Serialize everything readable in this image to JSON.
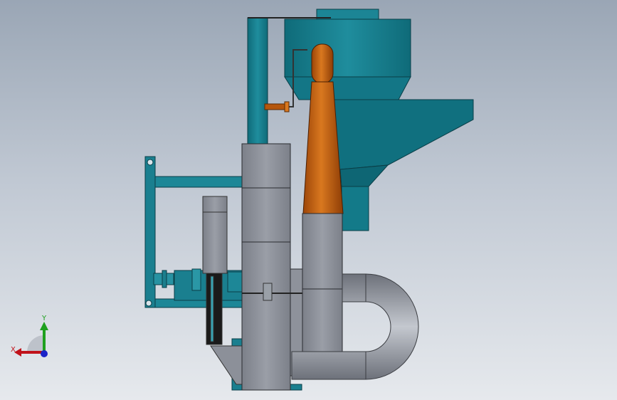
{
  "viewport": {
    "background_top": "#9aa6b5",
    "background_bottom": "#e6e9ed"
  },
  "colors": {
    "teal": "#1a7f8f",
    "teal_dark": "#0e5d6b",
    "teal_light": "#3aa4b3",
    "copper": "#b5560c",
    "copper_light": "#d9781f",
    "steel": "#8b8f99",
    "steel_dark": "#666a73",
    "steel_light": "#b4b8c1",
    "black": "#1a1a1a"
  },
  "triad": {
    "x_label": "X",
    "y_label": "Y",
    "x_color": "#c0121a",
    "y_color": "#1ea01e",
    "z_color": "#1b23c8"
  },
  "parts": [
    "cyclone-hopper",
    "vertical-duct",
    "copper-nozzle",
    "fan-housing",
    "motor",
    "frame",
    "u-pipe",
    "outlet-duct"
  ]
}
